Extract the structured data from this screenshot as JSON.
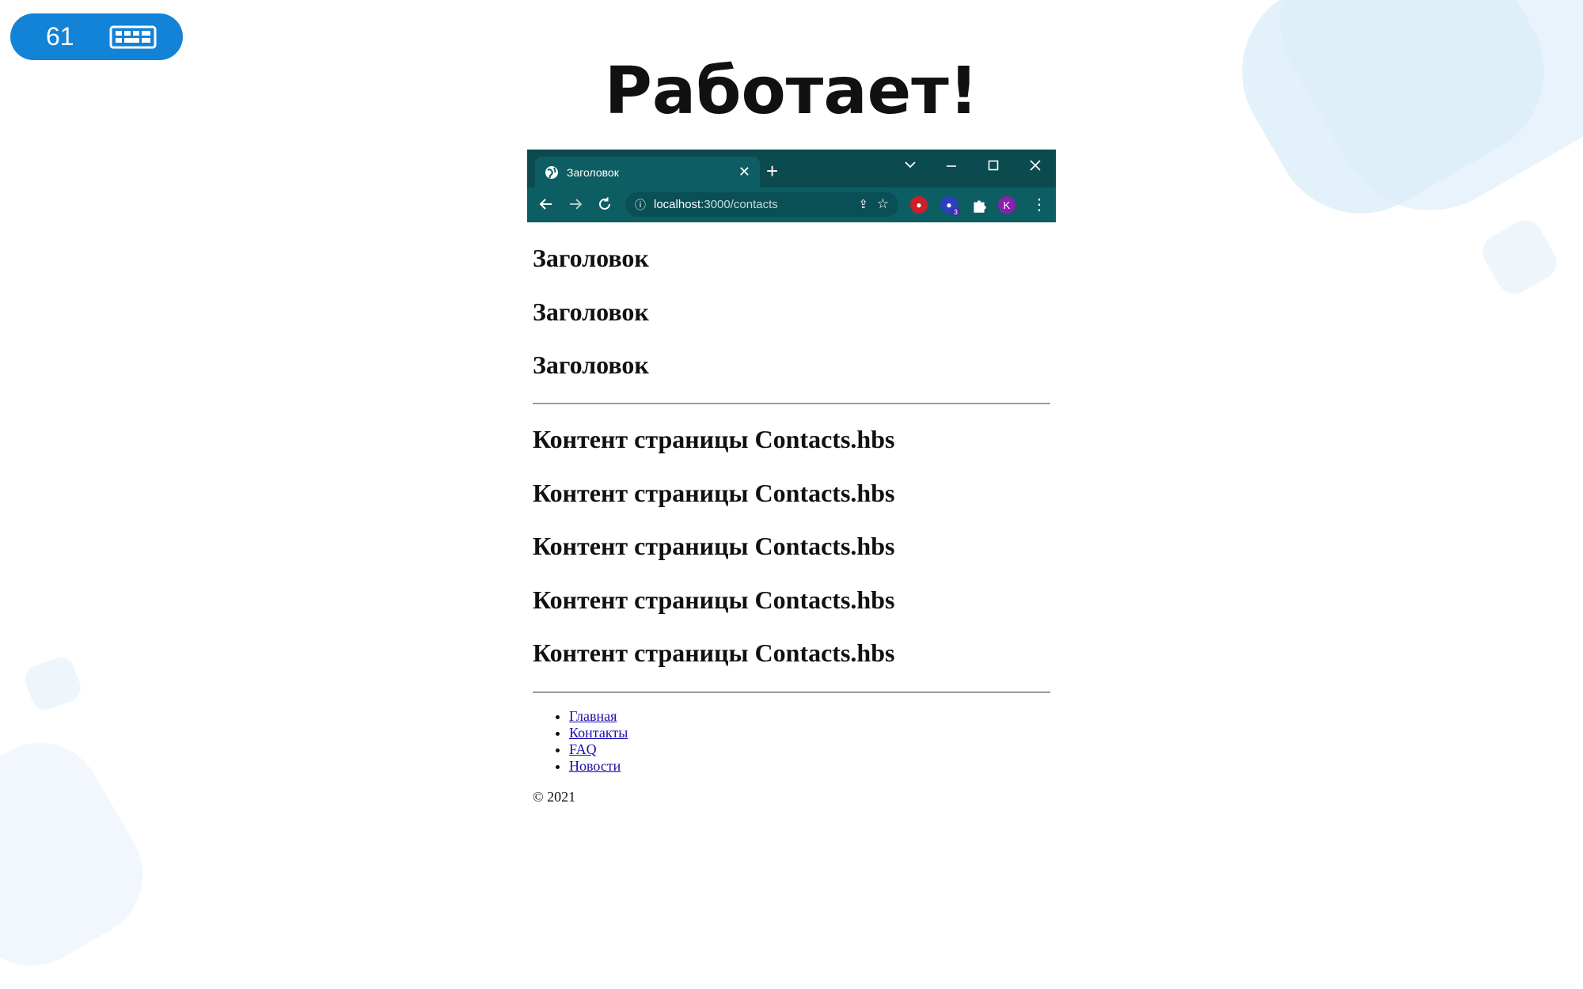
{
  "slide": {
    "number": "61",
    "title": "Работает!",
    "badge_color": "#1283d6"
  },
  "browser": {
    "tab_title": "Заголовок",
    "new_tab": "+",
    "tab_close": "✕",
    "url_host": "localhost",
    "url_path": ":3000/contacts",
    "profile_initial": "K",
    "extension_badge": "3",
    "colors": {
      "frame": "#0b4a4f",
      "toolbar": "#0d5e63"
    }
  },
  "page": {
    "headings": [
      "Заголовок",
      "Заголовок",
      "Заголовок"
    ],
    "contents": [
      "Контент страницы Contacts.hbs",
      "Контент страницы Contacts.hbs",
      "Контент страницы Contacts.hbs",
      "Контент страницы Contacts.hbs",
      "Контент страницы Contacts.hbs"
    ],
    "nav": [
      "Главная",
      "Контакты",
      "FAQ",
      "Новости"
    ],
    "copyright": "© 2021"
  }
}
